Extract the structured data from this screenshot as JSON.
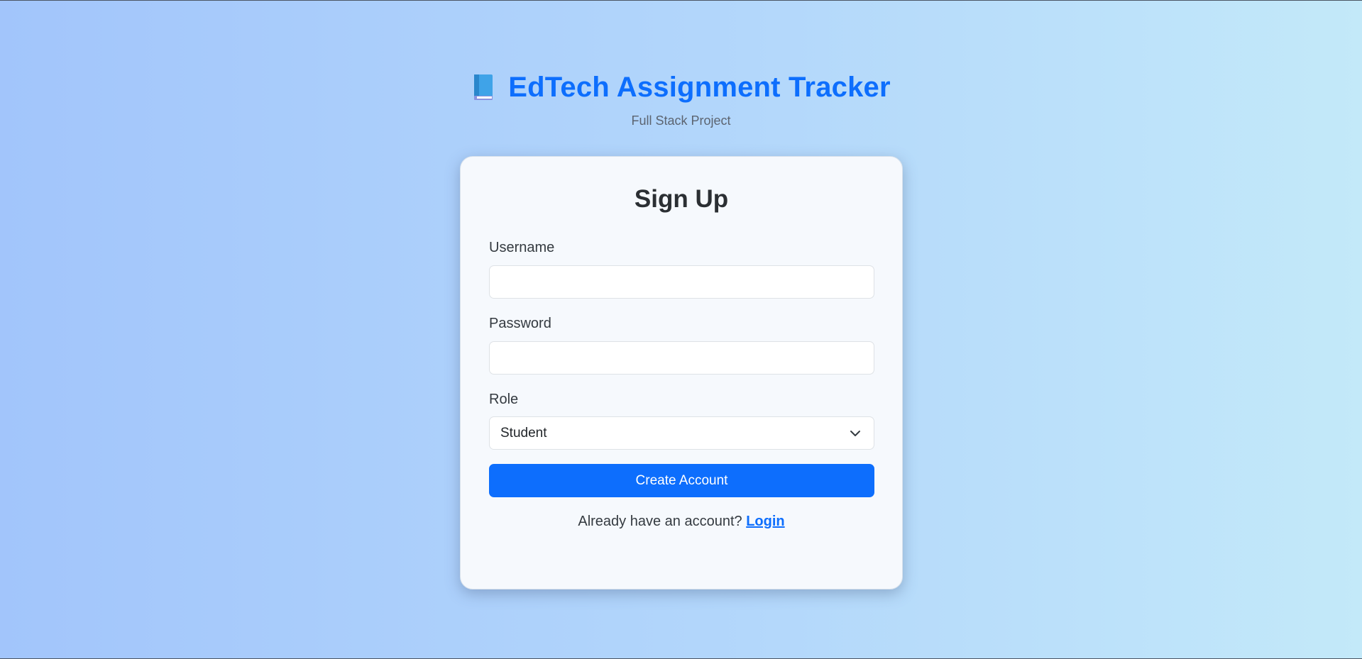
{
  "header": {
    "icon": "book-icon",
    "title": "EdTech Assignment Tracker",
    "subtitle": "Full Stack Project"
  },
  "form": {
    "title": "Sign Up",
    "username": {
      "label": "Username",
      "value": "",
      "placeholder": ""
    },
    "password": {
      "label": "Password",
      "value": "",
      "placeholder": ""
    },
    "role": {
      "label": "Role",
      "selected": "Student",
      "icon": "chevron-down-icon"
    },
    "submit_label": "Create Account",
    "footer_prefix": "Already have an account?",
    "login_link": "Login"
  },
  "colors": {
    "accent": "#0d6efd",
    "background_left": "#a2c5fb",
    "background_right": "#c3e9f9",
    "card": "#f6f9fd"
  }
}
